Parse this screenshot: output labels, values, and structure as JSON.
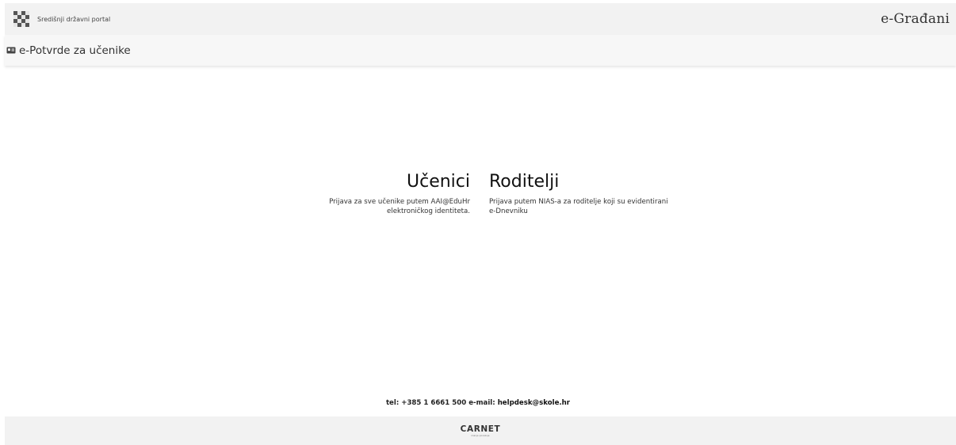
{
  "topbar": {
    "portal_name": "Središnji državni portal",
    "brand": "e-Građani"
  },
  "appbar": {
    "title": "e-Potvrde za učenike"
  },
  "login": {
    "students": {
      "title": "Učenici",
      "line1": "Prijava za sve učenike putem AAI@EduHr",
      "line2": "elektroničkog identiteta."
    },
    "parents": {
      "title": "Roditelji",
      "line1": "Prijava putem NIAS-a za roditelje koji su evidentirani",
      "line2": "e-Dnevniku"
    }
  },
  "contact": {
    "phone_text": "tel: +385 1 6661 500",
    "email_label": "e-mail:",
    "email": "helpdesk@skole.hr"
  },
  "footer": {
    "logo_text": "CARNET",
    "logo_sub": "znanje povezuje"
  },
  "colors": {
    "bar_bg": "#f2f2f2",
    "text": "#222222"
  }
}
